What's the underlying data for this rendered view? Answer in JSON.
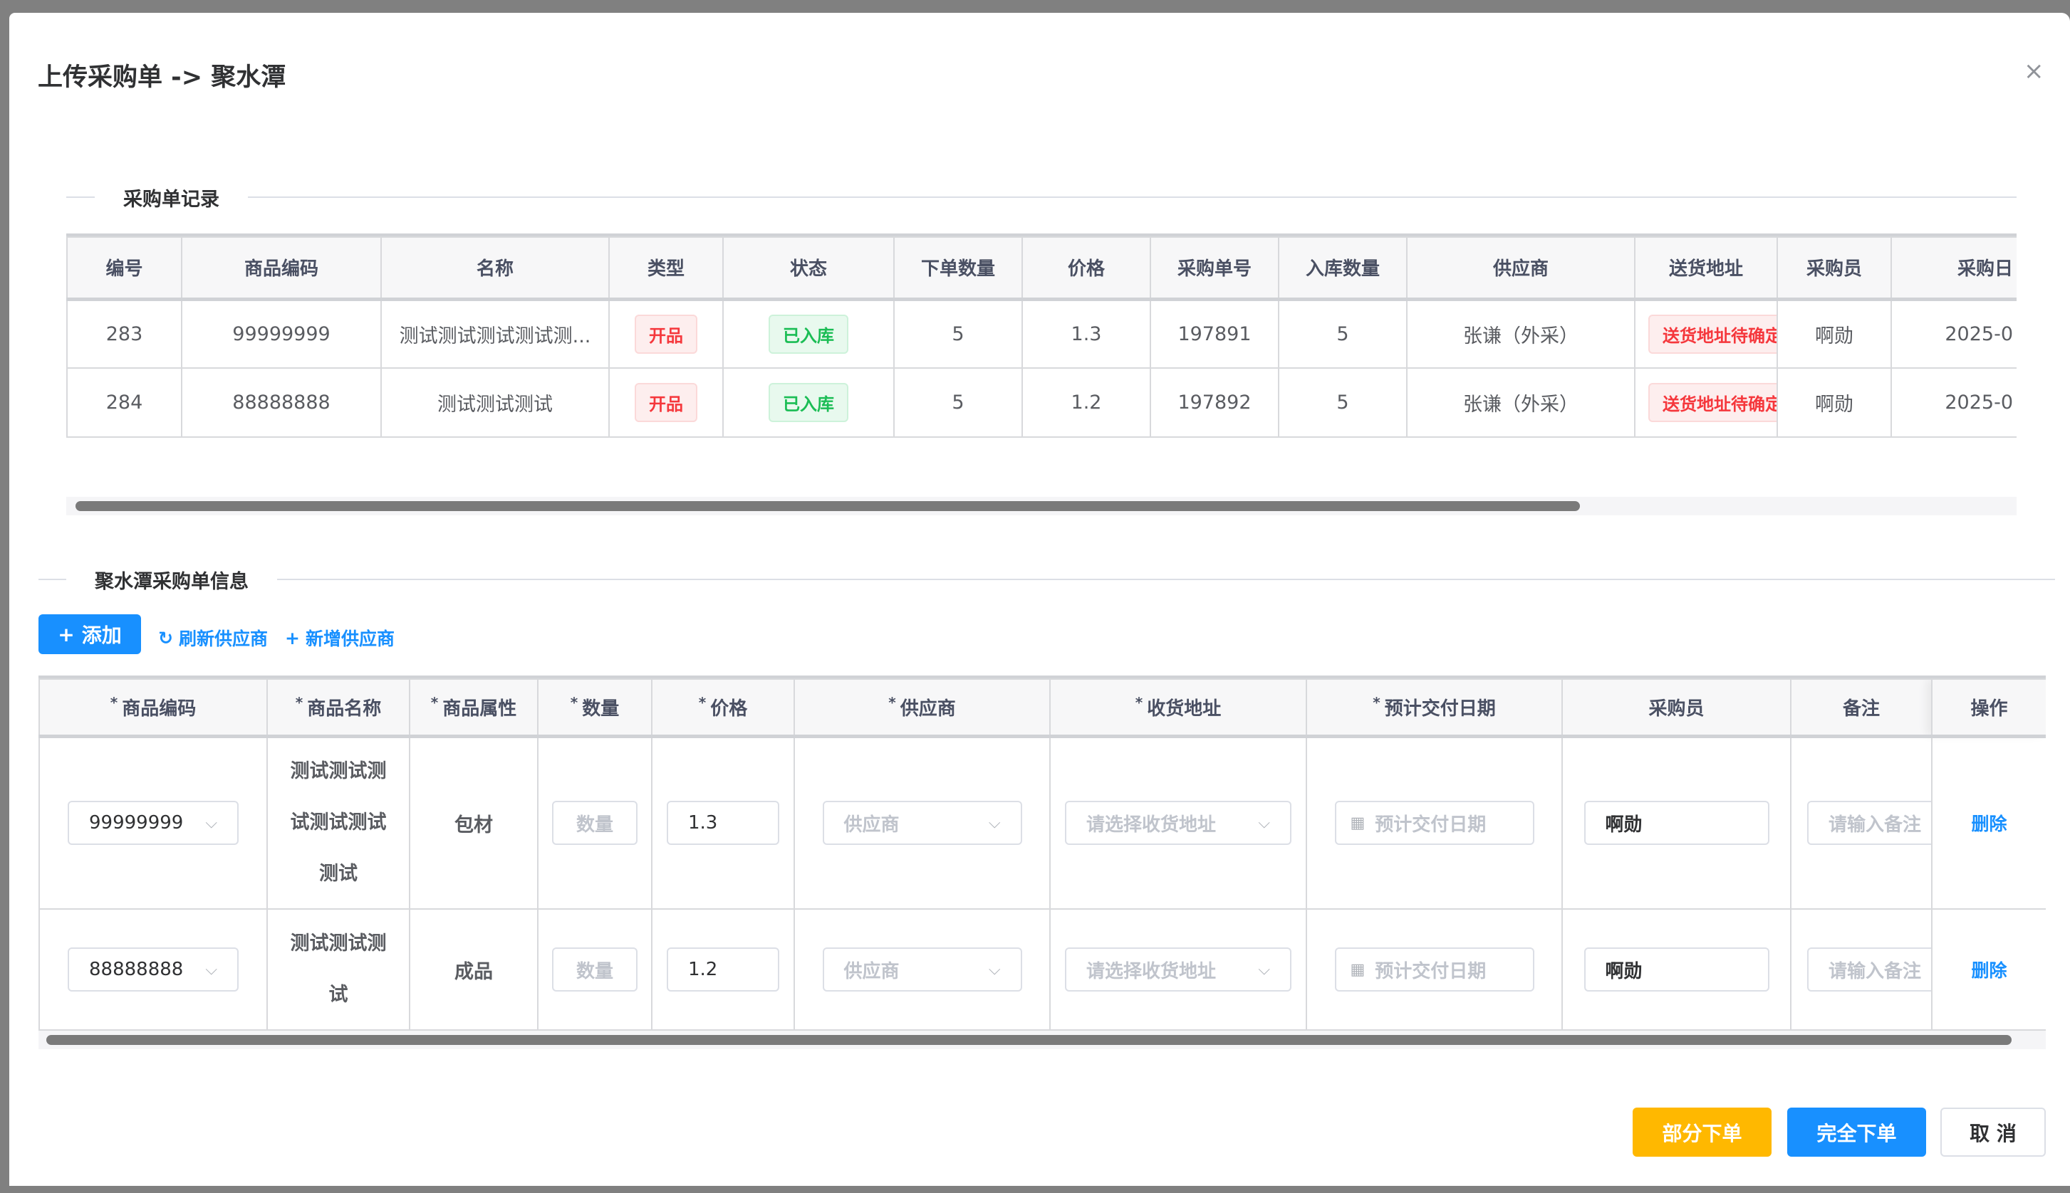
{
  "dialog": {
    "title": "上传采购单 -> 聚水潭",
    "close_icon": "×"
  },
  "records": {
    "section_title": "采购单记录",
    "columns": [
      "编号",
      "商品编码",
      "名称",
      "类型",
      "状态",
      "下单数量",
      "价格",
      "采购单号",
      "入库数量",
      "供应商",
      "送货地址",
      "采购员",
      "采购日"
    ],
    "rows": [
      {
        "id": "283",
        "code": "99999999",
        "name": "测试测试测试测试测...",
        "type": "开品",
        "status": "已入库",
        "qty": "5",
        "price": "1.3",
        "po": "197891",
        "in_qty": "5",
        "supplier": "张谦（外采）",
        "address": "送货地址待确定",
        "buyer": "啊勋",
        "date": "2025-0"
      },
      {
        "id": "284",
        "code": "88888888",
        "name": "测试测试测试",
        "type": "开品",
        "status": "已入库",
        "qty": "5",
        "price": "1.2",
        "po": "197892",
        "in_qty": "5",
        "supplier": "张谦（外采）",
        "address": "送货地址待确定",
        "buyer": "啊勋",
        "date": "2025-0"
      }
    ]
  },
  "info": {
    "section_title": "聚水潭采购单信息",
    "add_label": "添加",
    "refresh_label": "刷新供应商",
    "new_supplier_label": "新增供应商",
    "columns": [
      "商品编码",
      "商品名称",
      "商品属性",
      "数量",
      "价格",
      "供应商",
      "收货地址",
      "预计交付日期",
      "采购员",
      "备注",
      "操作"
    ],
    "required_mark": "*",
    "placeholders": {
      "qty": "数量",
      "supplier": "供应商",
      "address": "请选择收货地址",
      "date": "预计交付日期",
      "remark": "请输入备注"
    },
    "rows": [
      {
        "code": "99999999",
        "name": "测试测试测试测试测试测试",
        "attr": "包材",
        "price": "1.3",
        "buyer": "啊勋",
        "action": "删除"
      },
      {
        "code": "88888888",
        "name": "测试测试测试",
        "attr": "成品",
        "price": "1.2",
        "buyer": "啊勋",
        "action": "删除"
      }
    ]
  },
  "footer": {
    "partial_label": "部分下单",
    "full_label": "完全下单",
    "cancel_label": "取 消"
  },
  "colors": {
    "primary": "#1890ff",
    "warning": "#ffb800",
    "danger": "#f5373c",
    "success": "#1bbd55"
  }
}
